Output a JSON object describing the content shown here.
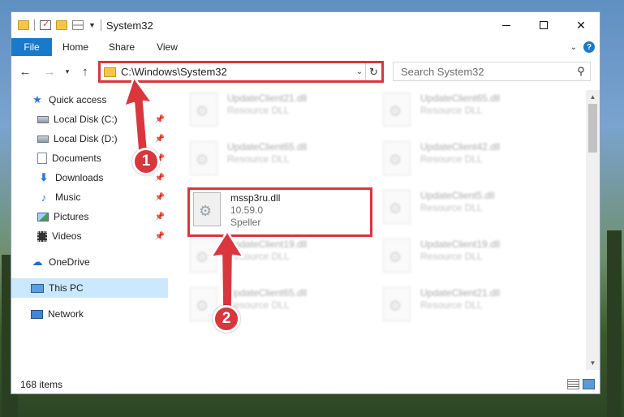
{
  "window": {
    "title": "System32",
    "controls": {
      "minimize": "minimize",
      "maximize": "maximize",
      "close": "✕"
    }
  },
  "ribbon": {
    "tabs": [
      "File",
      "Home",
      "Share",
      "View"
    ],
    "help": "?"
  },
  "address": {
    "path": "C:\\Windows\\System32",
    "search_placeholder": "Search System32"
  },
  "sidebar": {
    "quick_access": "Quick access",
    "items": [
      {
        "label": "Local Disk (C:)",
        "icon": "local-disk-icon",
        "pinned": true
      },
      {
        "label": "Local Disk (D:)",
        "icon": "local-disk-icon",
        "pinned": true
      },
      {
        "label": "Documents",
        "icon": "documents-icon",
        "pinned": true
      },
      {
        "label": "Downloads",
        "icon": "downloads-icon",
        "pinned": true
      },
      {
        "label": "Music",
        "icon": "music-icon",
        "pinned": true
      },
      {
        "label": "Pictures",
        "icon": "pictures-icon",
        "pinned": true
      },
      {
        "label": "Videos",
        "icon": "videos-icon",
        "pinned": true
      }
    ],
    "onedrive": "OneDrive",
    "this_pc": "This PC",
    "network": "Network"
  },
  "files": [
    {
      "name": "UpdateClient21.dll",
      "desc": "Resource DLL",
      "blurred": true
    },
    {
      "name": "UpdateClient65.dll",
      "desc": "Resource DLL",
      "blurred": true
    },
    {
      "name": "UpdateClient65.dll",
      "desc": "Resource DLL",
      "blurred": true
    },
    {
      "name": "UpdateClient42.dll",
      "desc": "Resource DLL",
      "blurred": true
    },
    {
      "name": "mssp3ru.dll",
      "version": "10.59.0",
      "desc": "Speller",
      "blurred": false
    },
    {
      "name": "UpdateClient5.dll",
      "desc": "Resource DLL",
      "blurred": true
    },
    {
      "name": "UpdateClient19.dll",
      "desc": "Resource DLL",
      "blurred": true
    },
    {
      "name": "UpdateClient19.dll",
      "desc": "Resource DLL",
      "blurred": true
    },
    {
      "name": "UpdateClient65.dll",
      "desc": "Resource DLL",
      "blurred": true
    },
    {
      "name": "UpdateClient21.dll",
      "desc": "Resource DLL",
      "blurred": true
    }
  ],
  "status": {
    "item_count": "168 items"
  },
  "callouts": [
    "1",
    "2"
  ],
  "colors": {
    "accent": "#1979ca",
    "highlight": "#d9363e",
    "selected": "#cce8ff"
  }
}
